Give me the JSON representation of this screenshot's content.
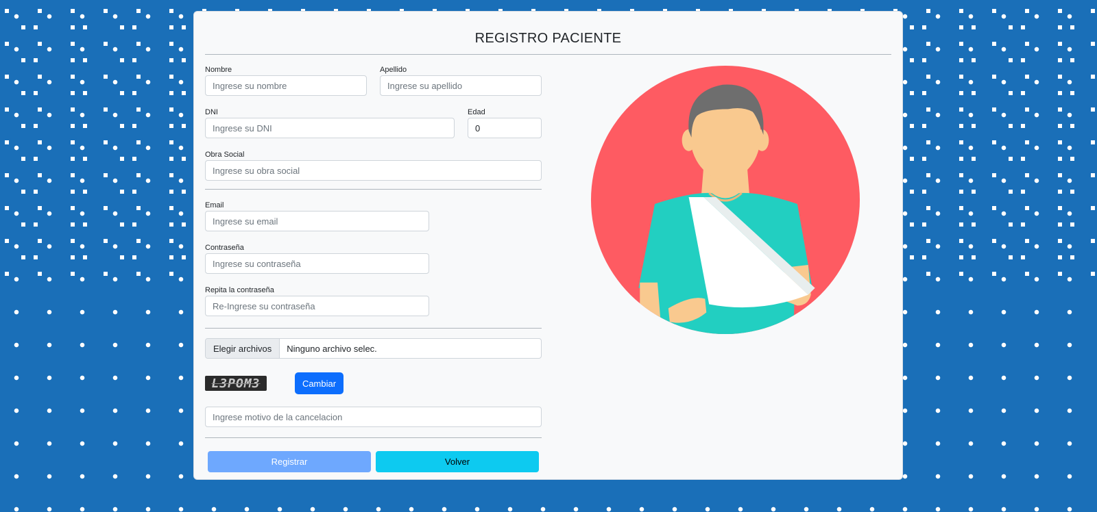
{
  "header": {
    "title": "REGISTRO PACIENTE"
  },
  "form": {
    "nombre": {
      "label": "Nombre",
      "placeholder": "Ingrese su nombre"
    },
    "apellido": {
      "label": "Apellido",
      "placeholder": "Ingrese su apellido"
    },
    "dni": {
      "label": "DNI",
      "placeholder": "Ingrese su DNI"
    },
    "edad": {
      "label": "Edad",
      "value": "0"
    },
    "obra_social": {
      "label": "Obra Social",
      "placeholder": "Ingrese su obra social"
    },
    "email": {
      "label": "Email",
      "placeholder": "Ingrese su email"
    },
    "password": {
      "label": "Contraseña",
      "placeholder": "Ingrese su contraseña"
    },
    "password_repeat": {
      "label": "Repita la contraseña",
      "placeholder": "Re-Ingrese su contraseña"
    },
    "file": {
      "button_label": "Elegir archivos",
      "status": "Ninguno archivo selec."
    },
    "captcha": {
      "text": "L3POM3",
      "change_label": "Cambiar"
    },
    "captcha_input": {
      "placeholder": "Ingrese motivo de la cancelacion"
    }
  },
  "actions": {
    "register_label": "Registrar",
    "back_label": "Volver"
  },
  "colors": {
    "primary": "#0d6efd",
    "primary_light": "#6ea8fe",
    "info": "#0dcaf0",
    "pattern_blue": "#1a6fb8",
    "avatar_circle": "#fe5b62",
    "shirt": "#22cfc1"
  },
  "illustration": "patient-with-arm-sling-icon"
}
